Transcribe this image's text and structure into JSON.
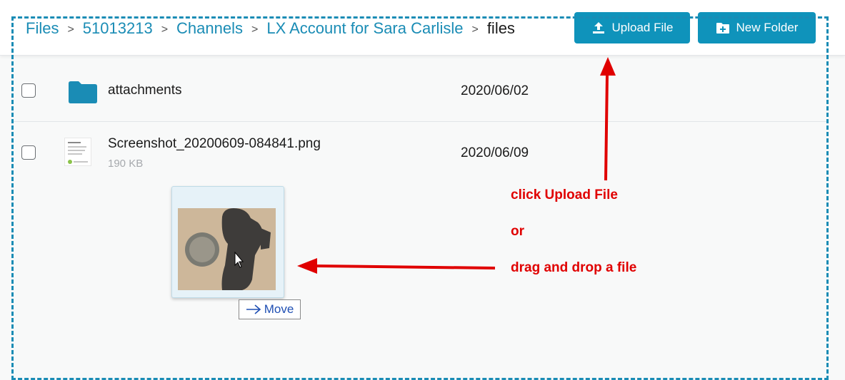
{
  "breadcrumb": {
    "items": [
      "Files",
      "51013213",
      "Channels",
      "LX Account for Sara Carlisle"
    ],
    "separator": ">",
    "current": "files"
  },
  "toolbar": {
    "upload_label": "Upload File",
    "new_folder_label": "New Folder"
  },
  "files": [
    {
      "name": "attachments",
      "type": "folder",
      "size": "",
      "date": "2020/06/02"
    },
    {
      "name": "Screenshot_20200609-084841.png",
      "type": "image",
      "size": "190 KB",
      "date": "2020/06/09"
    }
  ],
  "drag": {
    "tooltip": "Move"
  },
  "annotations": {
    "line1": "click Upload File",
    "line2": "or",
    "line3": "drag and drop a file"
  },
  "colors": {
    "accent": "#0f93bb",
    "link": "#1a8cb5",
    "annotation": "#e00000"
  },
  "icons": {
    "upload": "upload-icon",
    "new_folder": "folder-plus-icon",
    "folder": "folder-icon",
    "move_arrow": "arrow-right-icon"
  }
}
